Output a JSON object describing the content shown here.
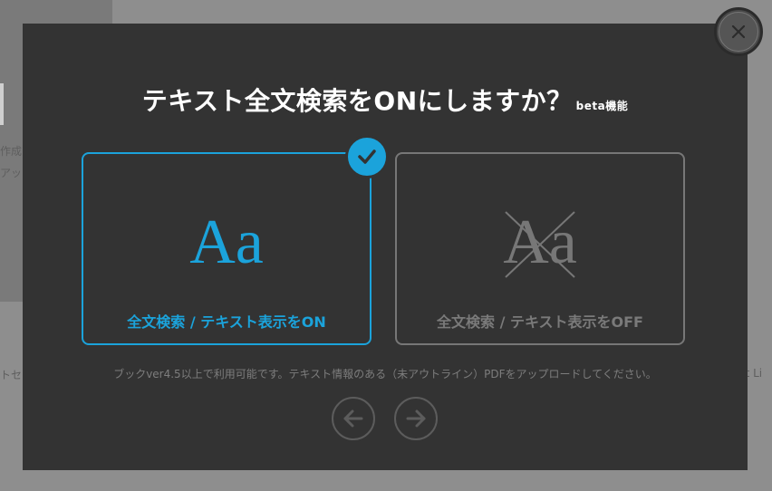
{
  "background": {
    "left_texts": [
      "作成",
      "アッ",
      "トセ"
    ],
    "right_text": "ht Li"
  },
  "modal": {
    "title": "テキスト全文検索をONにしますか？",
    "title_badge": "beta機能",
    "options": [
      {
        "label": "全文検索 / テキスト表示をON",
        "glyph": "Aa",
        "selected": true
      },
      {
        "label": "全文検索 / テキスト表示をOFF",
        "glyph": "Aa",
        "selected": false
      }
    ],
    "note": "ブックver4.5以上で利用可能です。テキスト情報のある（未アウトライン）PDFをアップロードしてください。",
    "icons": {
      "close": "close-icon",
      "check": "check-icon",
      "prev": "arrow-left-icon",
      "next": "arrow-right-icon"
    }
  },
  "colors": {
    "accent": "#1ba3db",
    "modal_bg": "#333333",
    "disabled": "#7a7a7a"
  }
}
